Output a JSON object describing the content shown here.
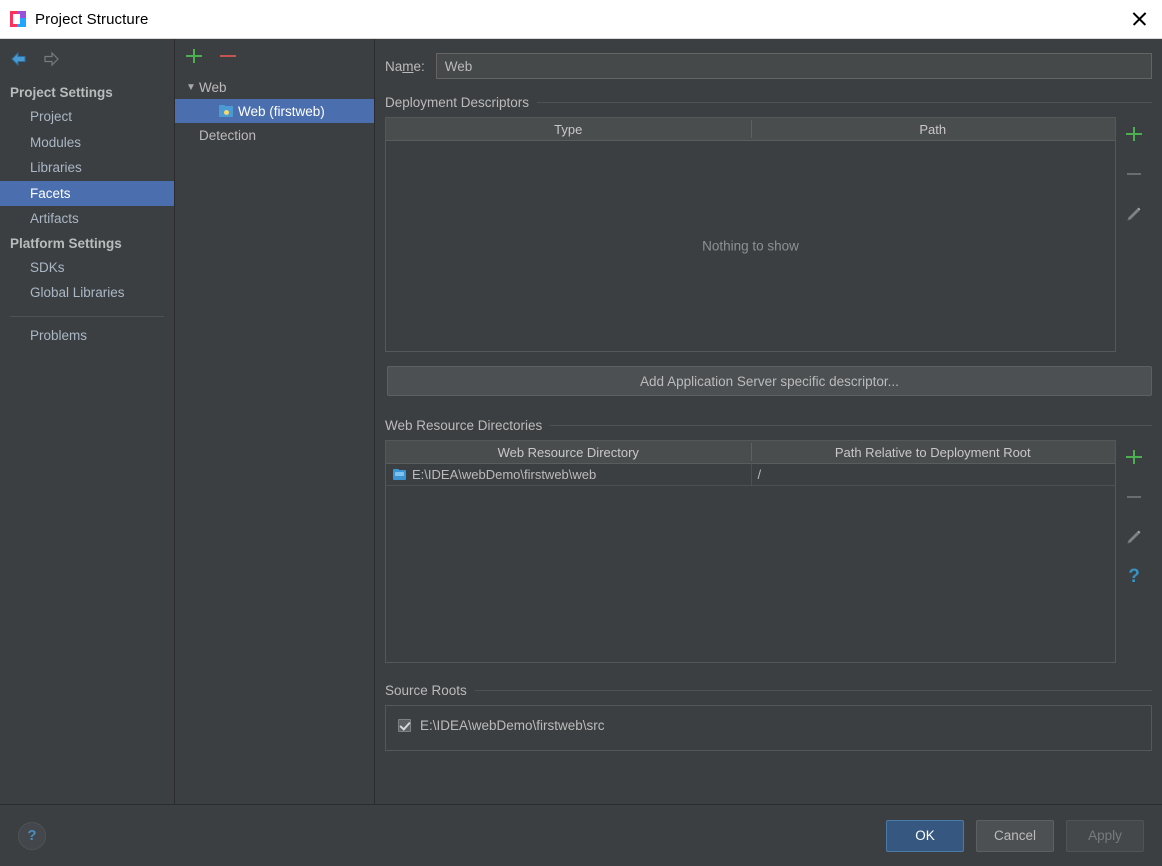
{
  "window": {
    "title": "Project Structure",
    "app_icon": "intellij-idea-icon",
    "close_label": "×"
  },
  "nav": {
    "back_icon": "back-arrow-icon",
    "forward_icon": "forward-arrow-icon"
  },
  "sidebar": {
    "groups": [
      {
        "label": "Project Settings",
        "items": [
          {
            "label": "Project",
            "selected": false
          },
          {
            "label": "Modules",
            "selected": false
          },
          {
            "label": "Libraries",
            "selected": false
          },
          {
            "label": "Facets",
            "selected": true
          },
          {
            "label": "Artifacts",
            "selected": false
          }
        ]
      },
      {
        "label": "Platform Settings",
        "items": [
          {
            "label": "SDKs",
            "selected": false
          },
          {
            "label": "Global Libraries",
            "selected": false
          }
        ]
      }
    ],
    "extra_items": [
      {
        "label": "Problems",
        "selected": false
      }
    ]
  },
  "tree": {
    "toolbar": {
      "add_icon": "plus-icon",
      "remove_icon": "minus-icon"
    },
    "nodes": [
      {
        "label": "Web",
        "type": "group",
        "expanded": true,
        "selected": false
      },
      {
        "label": "Web (firstweb)",
        "type": "facet",
        "icon": "web-facet-icon",
        "selected": true
      },
      {
        "label": "Detection",
        "type": "group",
        "selected": false
      }
    ]
  },
  "main": {
    "name": {
      "label_prefix": "Na",
      "label_mnemonic": "m",
      "label_suffix": "e:",
      "value": "Web",
      "placeholder": ""
    },
    "deployment_descriptors": {
      "title": "Deployment Descriptors",
      "columns": [
        "Type",
        "Path"
      ],
      "rows": [],
      "empty_text": "Nothing to show",
      "toolbar": [
        {
          "icon": "plus-icon",
          "name": "add-descriptor-button",
          "enabled": true
        },
        {
          "icon": "minus-icon",
          "name": "remove-descriptor-button",
          "enabled": false
        },
        {
          "icon": "pencil-icon",
          "name": "edit-descriptor-button",
          "enabled": false
        }
      ],
      "add_button_label": "Add Application Server specific descriptor..."
    },
    "web_resource_directories": {
      "title": "Web Resource Directories",
      "columns": [
        "Web Resource Directory",
        "Path Relative to Deployment Root"
      ],
      "rows": [
        {
          "directory": "E:\\IDEA\\webDemo\\firstweb\\web",
          "relative_path": "/",
          "icon": "folder-icon"
        }
      ],
      "toolbar": [
        {
          "icon": "plus-icon",
          "name": "add-web-resource-button",
          "enabled": true
        },
        {
          "icon": "minus-icon",
          "name": "remove-web-resource-button",
          "enabled": false
        },
        {
          "icon": "pencil-icon",
          "name": "edit-web-resource-button",
          "enabled": false
        },
        {
          "icon": "question-icon",
          "name": "web-resource-help-button",
          "enabled": true
        }
      ]
    },
    "source_roots": {
      "title": "Source Roots",
      "items": [
        {
          "label": "E:\\IDEA\\webDemo\\firstweb\\src",
          "checked": true
        }
      ]
    }
  },
  "footer": {
    "help_icon": "question-icon",
    "ok_label": "OK",
    "cancel_label": "Cancel",
    "apply_label": "Apply",
    "apply_enabled": false
  },
  "colors": {
    "background": "#3c3f41",
    "selection": "#4b6eaf",
    "accent_primary": "#365880",
    "plus_green": "#4caf50",
    "minus_red": "#c75450",
    "link_blue": "#3592c4",
    "text": "#bbbbbb"
  }
}
